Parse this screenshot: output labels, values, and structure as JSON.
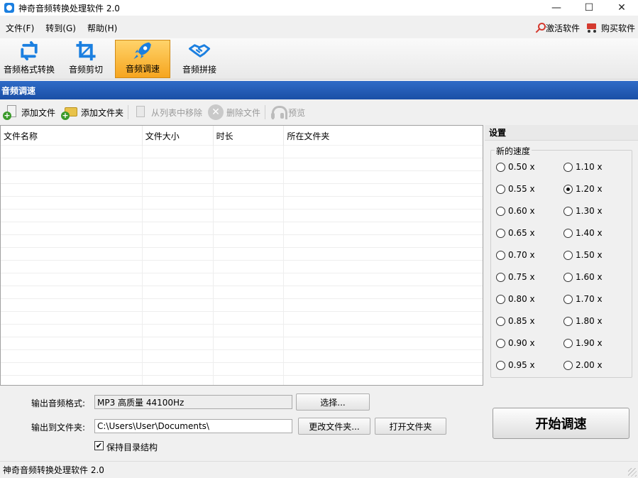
{
  "window": {
    "title": "神奇音频转换处理软件 2.0",
    "controls": {
      "minimize": "—",
      "maximize": "☐",
      "close": "✕"
    }
  },
  "menu": {
    "items": [
      "文件(F)",
      "转到(G)",
      "帮助(H)"
    ],
    "activate_label": "激活软件",
    "buy_label": "购买软件"
  },
  "toolbar": {
    "tools": [
      {
        "label": "音频格式转换",
        "icon": "convert-icon",
        "active": false
      },
      {
        "label": "音频剪切",
        "icon": "crop-icon",
        "active": false
      },
      {
        "label": "音频调速",
        "icon": "rocket-icon",
        "active": true
      },
      {
        "label": "音频拼接",
        "icon": "handshake-icon",
        "active": false
      }
    ],
    "accent": "#1b7fe0"
  },
  "section": {
    "title": "音频调速"
  },
  "list_toolbar": {
    "add_file": "添加文件",
    "add_folder": "添加文件夹",
    "remove_from_list": "从列表中移除",
    "delete_file": "删除文件",
    "preview": "预览"
  },
  "table": {
    "columns": [
      "文件名称",
      "文件大小",
      "时长",
      "所在文件夹"
    ],
    "rows": []
  },
  "settings": {
    "title": "设置",
    "speed_legend": "新的速度",
    "speeds": [
      "0.50 x",
      "1.10 x",
      "0.55 x",
      "1.20 x",
      "0.60 x",
      "1.30 x",
      "0.65 x",
      "1.40 x",
      "0.70 x",
      "1.50 x",
      "0.75 x",
      "1.60 x",
      "0.80 x",
      "1.70 x",
      "0.85 x",
      "1.80 x",
      "0.90 x",
      "1.90 x",
      "0.95 x",
      "2.00 x"
    ],
    "selected_speed": "1.20 x"
  },
  "output": {
    "format_label": "输出音频格式:",
    "format_value": "MP3 高质量 44100Hz",
    "choose_button": "选择...",
    "folder_label": "输出到文件夹:",
    "folder_value": "C:\\Users\\User\\Documents\\",
    "change_folder_button": "更改文件夹...",
    "open_folder_button": "打开文件夹",
    "keep_structure_label": "保持目录结构",
    "keep_structure_checked": true
  },
  "start_button": "开始调速",
  "status": {
    "text": "神奇音频转换处理软件 2.0"
  }
}
